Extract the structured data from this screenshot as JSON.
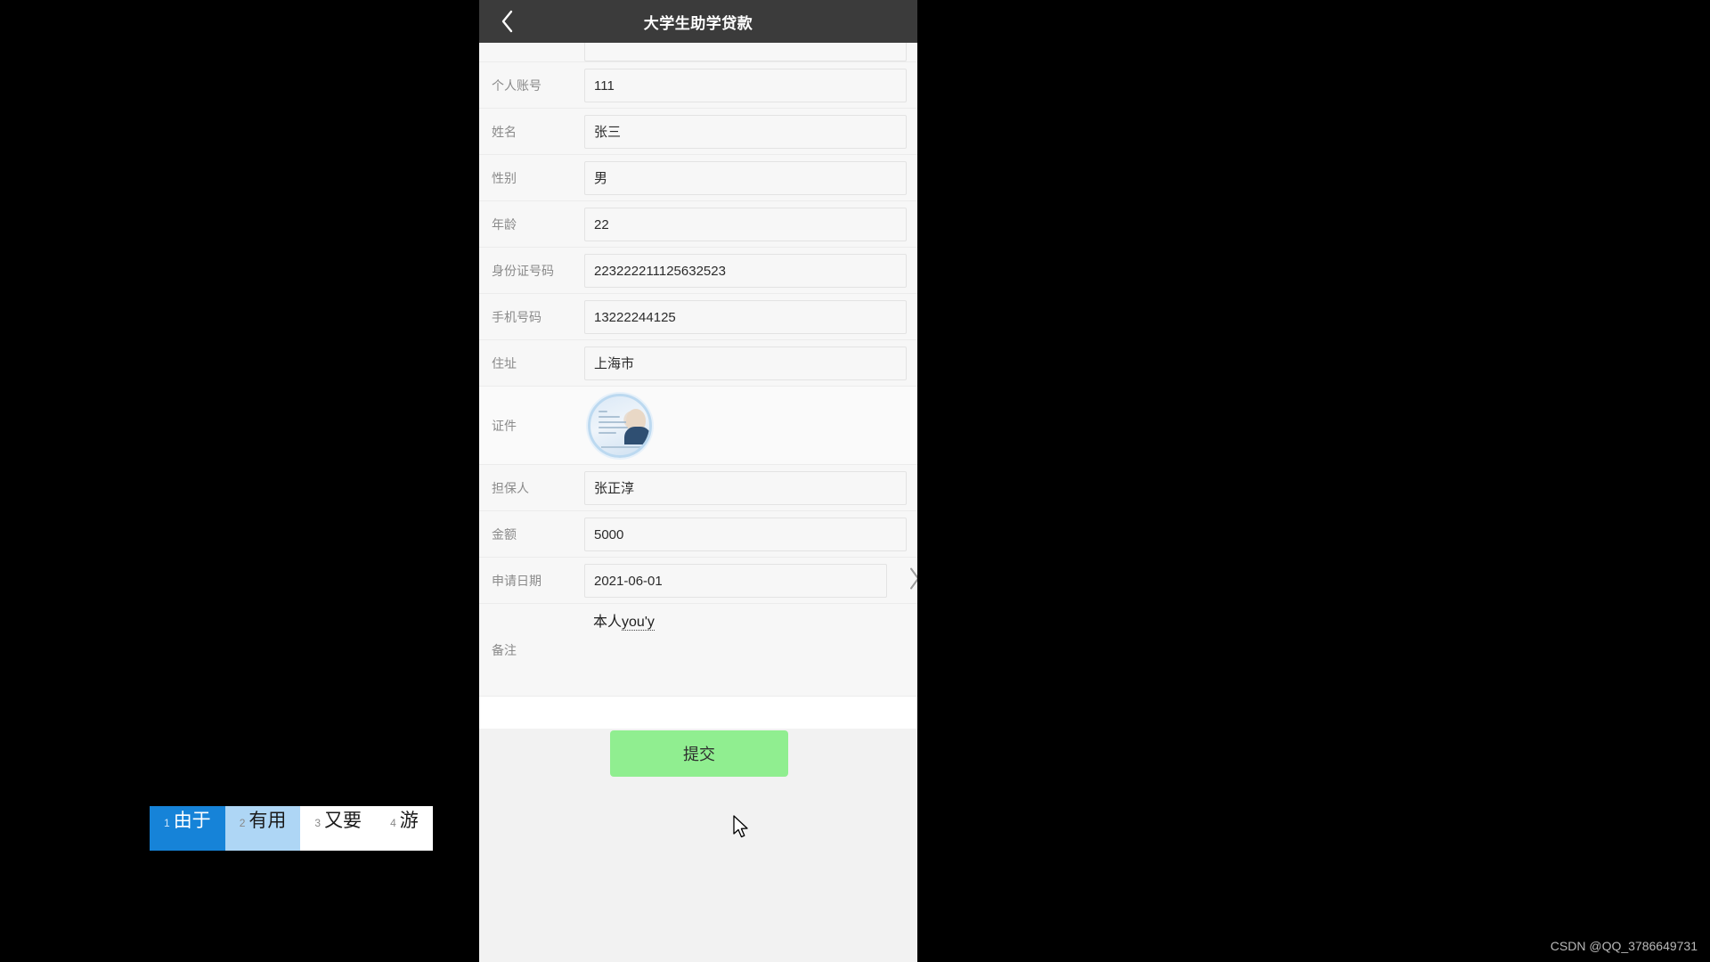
{
  "header": {
    "title": "大学生助学贷款",
    "back_icon": "chevron-left-icon"
  },
  "form": {
    "clipped_row": {
      "label": "",
      "value": ""
    },
    "fields": [
      {
        "label": "个人账号",
        "value": "111",
        "icon": ""
      },
      {
        "label": "姓名",
        "value": "张三",
        "icon": ""
      },
      {
        "label": "性别",
        "value": "男",
        "icon": ""
      },
      {
        "label": "年龄",
        "value": "22",
        "icon": ""
      },
      {
        "label": "身份证号码",
        "value": "223222211125632523",
        "icon": ""
      },
      {
        "label": "手机号码",
        "value": "13222244125",
        "icon": ""
      },
      {
        "label": "住址",
        "value": "上海市",
        "icon": ""
      }
    ],
    "certificate": {
      "label": "证件",
      "image_name": "id-card-photo"
    },
    "fields2": [
      {
        "label": "担保人",
        "value": "张正淳"
      },
      {
        "label": "金额",
        "value": "5000"
      }
    ],
    "date_field": {
      "label": "申请日期",
      "value": "2021-06-01",
      "chevron_icon": "chevron-right-icon"
    },
    "remarks": {
      "label": "备注",
      "committed_text": "本人",
      "composing_text": "you'y"
    }
  },
  "ime": {
    "candidates": [
      {
        "index": "1",
        "text": "由于",
        "state": "selected"
      },
      {
        "index": "2",
        "text": "有用",
        "state": "hover"
      },
      {
        "index": "3",
        "text": "又要",
        "state": "normal"
      },
      {
        "index": "4",
        "text": "游",
        "state": "normal"
      }
    ]
  },
  "footer": {
    "submit_label": "提交"
  },
  "watermark": {
    "text": "CSDN @QQ_3786649731"
  },
  "colors": {
    "titlebar_bg": "#3b3b3b",
    "ime_selected": "#1683d8",
    "ime_hover": "#aed6f5",
    "submit_bg": "#90ee90",
    "backdrop": "#000000"
  }
}
